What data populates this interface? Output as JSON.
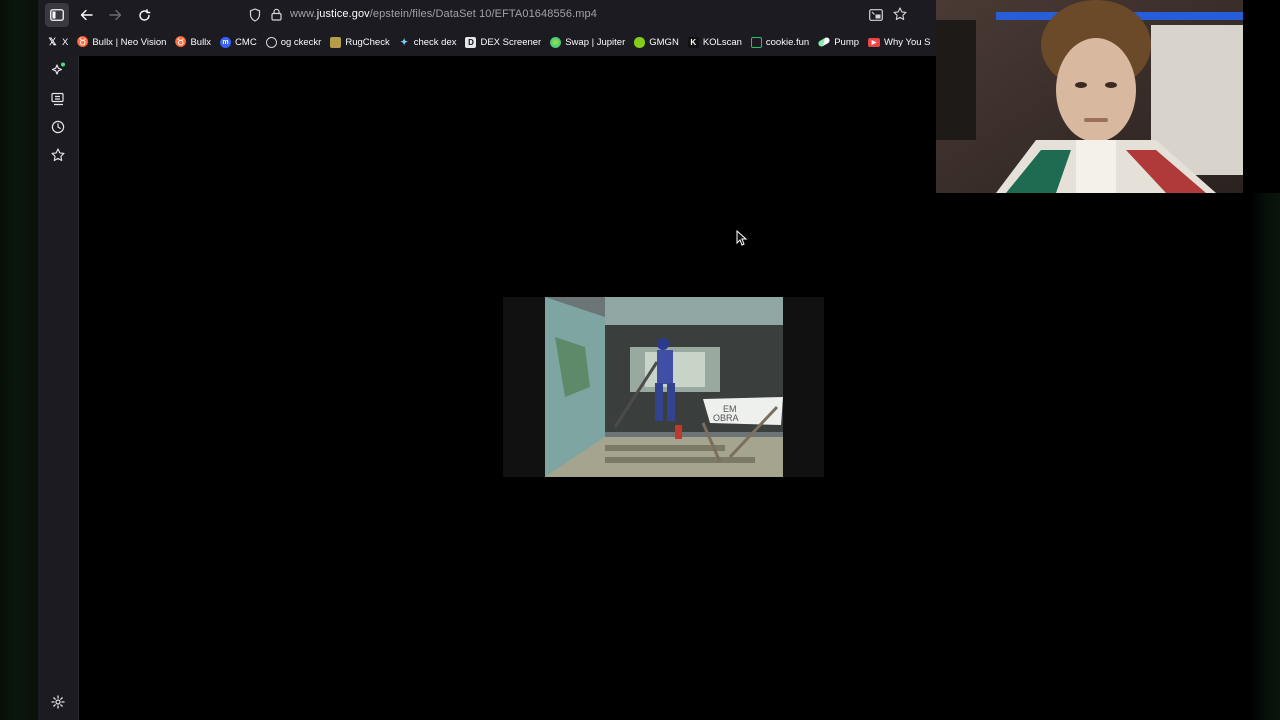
{
  "browser": {
    "url": {
      "prefix": "www.",
      "host": "justice.gov",
      "path": "/epstein/files/DataSet 10/EFTA01648556.mp4"
    },
    "bookmarks": [
      {
        "label": "X",
        "icon": "x-logo-icon",
        "color": "#000000"
      },
      {
        "label": "Bullx | Neo Vision",
        "icon": "bullx-icon",
        "color": "#22c55e"
      },
      {
        "label": "Bullx",
        "icon": "bullx-icon",
        "color": "#22c55e"
      },
      {
        "label": "CMC",
        "icon": "cmc-icon",
        "color": "#3861fb"
      },
      {
        "label": "og ckeckr",
        "icon": "globe-icon",
        "color": "#9ca3af"
      },
      {
        "label": "RugCheck",
        "icon": "rugcheck-icon",
        "color": "#b59b4a"
      },
      {
        "label": "check dex",
        "icon": "dex-icon",
        "color": "#7dd3fc"
      },
      {
        "label": "DEX Screener",
        "icon": "dexscreener-icon",
        "color": "#e5e7eb"
      },
      {
        "label": "Swap | Jupiter",
        "icon": "jupiter-icon",
        "color": "#a3e635"
      },
      {
        "label": "GMGN",
        "icon": "gmgn-icon",
        "color": "#84cc16"
      },
      {
        "label": "KOLscan",
        "icon": "kolscan-icon",
        "color": "#111111"
      },
      {
        "label": "cookie.fun",
        "icon": "cookie-icon",
        "color": "#22c55e"
      },
      {
        "label": "Pump",
        "icon": "pump-icon",
        "color": "#86efac"
      },
      {
        "label": "Why You S",
        "icon": "youtube-icon",
        "color": "#ef4444"
      }
    ]
  },
  "colors": {
    "chrome_bg": "#1c1b22",
    "text": "#fbfbfe",
    "muted": "#a1a1aa",
    "content_bg": "#000000"
  }
}
